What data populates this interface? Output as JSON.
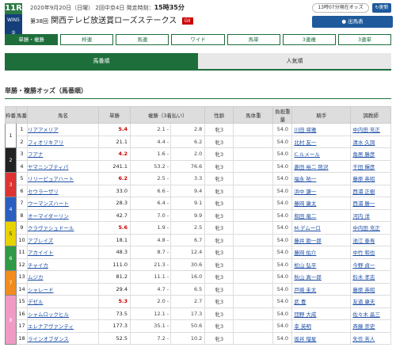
{
  "header": {
    "race_no": "11R",
    "win5_label": "WIN5 ⑤",
    "date": "2020年9月20日（日曜）",
    "meeting": "2回中京4日",
    "post_label": "発走時刻：",
    "post_time": "15時35分",
    "ordinal": "第38回",
    "race_name": "関西テレビ放送賞ローズステークス",
    "grade": "GII",
    "odds_time": "13時07分現在オッズ",
    "refresh_label": "更新",
    "runners_label": "出馬表"
  },
  "tabs": [
    "単勝・複勝",
    "枠連",
    "馬連",
    "ワイド",
    "馬単",
    "3連複",
    "3連単"
  ],
  "subtabs": [
    "馬番順",
    "人気順"
  ],
  "section_title": "単勝・複勝オッズ（馬番順）",
  "columns": [
    "枠番",
    "馬番",
    "馬名",
    "単勝",
    "複勝（3着払い）",
    "性齢",
    "馬体重",
    "負担重量",
    "騎手",
    "調教師"
  ],
  "rows": [
    {
      "waku": "1",
      "no": "1",
      "name": "リアアメリア",
      "win": "5.4",
      "pmin": "2.1",
      "pmax": "2.8",
      "sex": "牝3",
      "wt": "54.0",
      "jockey": "川田 将雅",
      "trainer": "中内田 充正"
    },
    {
      "waku": "",
      "no": "2",
      "name": "フィオリキアリ",
      "win": "21.1",
      "pmin": "4.4",
      "pmax": "6.2",
      "sex": "牝3",
      "wt": "54.0",
      "jockey": "北村 友一",
      "trainer": "清水 久詞"
    },
    {
      "waku": "2",
      "no": "3",
      "name": "フアナ",
      "win": "4.2",
      "pmin": "1.6",
      "pmax": "2.0",
      "sex": "牝3",
      "wt": "54.0",
      "jockey": "C.ルメール",
      "trainer": "角居 勝彦"
    },
    {
      "waku": "",
      "no": "4",
      "name": "ヤマニンプティパ",
      "win": "241.1",
      "pmin": "53.2",
      "pmax": "76.6",
      "sex": "牝3",
      "wt": "54.0",
      "jockey": "菱田 裕二 熊沢",
      "trainer": "千田 輝彦"
    },
    {
      "waku": "3",
      "no": "5",
      "name": "リリーピュアハート",
      "win": "6.2",
      "pmin": "2.5",
      "pmax": "3.3",
      "sex": "牝3",
      "wt": "54.0",
      "jockey": "福永 祐一",
      "trainer": "藤原 英昭"
    },
    {
      "waku": "",
      "no": "6",
      "name": "セウラーザリ",
      "win": "33.0",
      "pmin": "6.6",
      "pmax": "9.4",
      "sex": "牝3",
      "wt": "54.0",
      "jockey": "浜中 謙一",
      "trainer": "西浦 正樹"
    },
    {
      "waku": "4",
      "no": "7",
      "name": "ウーマンズハート",
      "win": "28.3",
      "pmin": "6.4",
      "pmax": "9.1",
      "sex": "牝3",
      "wt": "54.0",
      "jockey": "藤岡 康太",
      "trainer": "西浦 勝一"
    },
    {
      "waku": "",
      "no": "8",
      "name": "オーマイダーリン",
      "win": "42.7",
      "pmin": "7.0",
      "pmax": "9.9",
      "sex": "牝3",
      "wt": "54.0",
      "jockey": "和田 竜二",
      "trainer": "河内 洋"
    },
    {
      "waku": "5",
      "no": "9",
      "name": "クラヴァシュドール",
      "win": "5.6",
      "pmin": "1.9",
      "pmax": "2.5",
      "sex": "牝3",
      "wt": "54.0",
      "jockey": "M.デムーロ",
      "trainer": "中内田 充正"
    },
    {
      "waku": "",
      "no": "10",
      "name": "アブレイズ",
      "win": "18.1",
      "pmin": "4.8",
      "pmax": "6.7",
      "sex": "牝3",
      "wt": "54.0",
      "jockey": "藤井 勘一郎",
      "trainer": "池江 泰寿"
    },
    {
      "waku": "6",
      "no": "11",
      "name": "アカイイト",
      "win": "48.3",
      "pmin": "8.7",
      "pmax": "12.4",
      "sex": "牝3",
      "wt": "54.0",
      "jockey": "藤岡 佑介",
      "trainer": "中竹 和也"
    },
    {
      "waku": "",
      "no": "12",
      "name": "チャイカ",
      "win": "111.0",
      "pmin": "21.3",
      "pmax": "30.6",
      "sex": "牝3",
      "wt": "54.0",
      "jockey": "松山 弘平",
      "trainer": "今野 貞一"
    },
    {
      "waku": "7",
      "no": "13",
      "name": "ムジカ",
      "win": "81.2",
      "pmin": "11.1",
      "pmax": "16.0",
      "sex": "牝3",
      "wt": "54.0",
      "jockey": "秋山 真一郎",
      "trainer": "鈴木 孝志"
    },
    {
      "waku": "",
      "no": "14",
      "name": "シャレード",
      "win": "29.4",
      "pmin": "4.7",
      "pmax": "6.5",
      "sex": "牝3",
      "wt": "54.0",
      "jockey": "戸崎 圭太",
      "trainer": "藤原 英昭"
    },
    {
      "waku": "8",
      "no": "15",
      "name": "デゼル",
      "win": "5.3",
      "pmin": "2.0",
      "pmax": "2.7",
      "sex": "牝3",
      "wt": "54.0",
      "jockey": "武 豊",
      "trainer": "友道 康夫"
    },
    {
      "waku": "",
      "no": "16",
      "name": "シャムロックヒル",
      "win": "73.5",
      "pmin": "12.1",
      "pmax": "17.3",
      "sex": "牝3",
      "wt": "54.0",
      "jockey": "団野 大成",
      "trainer": "佐々木 晶三"
    },
    {
      "waku": "",
      "no": "17",
      "name": "エレナアヴァンティ",
      "win": "177.3",
      "pmin": "35.1",
      "pmax": "50.6",
      "sex": "牝3",
      "wt": "54.0",
      "jockey": "幸 英明",
      "trainer": "斉藤 崇史"
    },
    {
      "waku": "",
      "no": "18",
      "name": "ラインオブダンス",
      "win": "52.5",
      "pmin": "7.2",
      "pmax": "10.2",
      "sex": "牝3",
      "wt": "54.0",
      "jockey": "坂井 瑠星",
      "trainer": "矢作 芳人"
    }
  ],
  "colors": {
    "accent": "#1e6e3c",
    "hot_odds": "#c00",
    "link": "#1e4fa6",
    "grade": "#c00",
    "button": "#1e5a9c"
  }
}
